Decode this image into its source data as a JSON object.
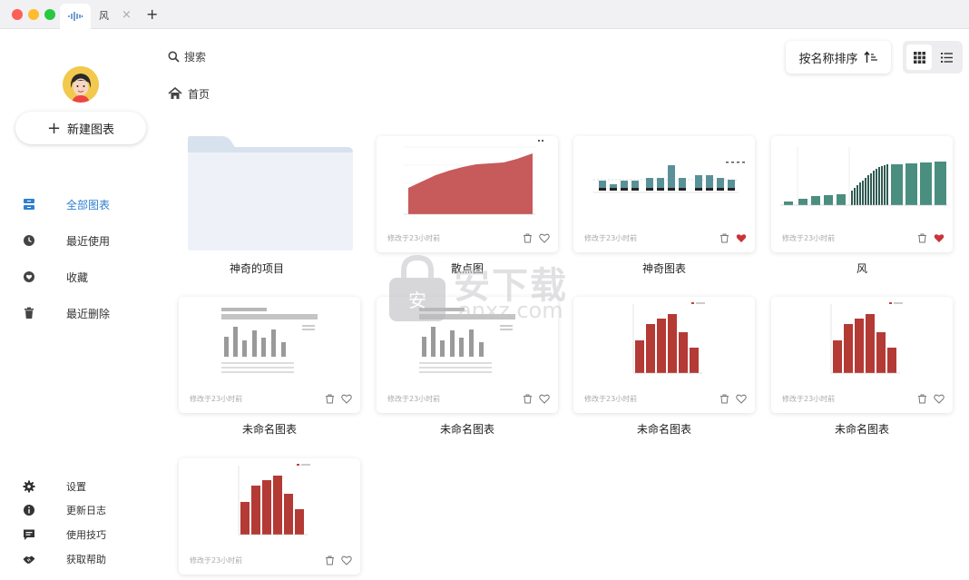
{
  "window": {
    "tabs": [
      {
        "label": "",
        "icon": "waveform-icon",
        "active": true
      },
      {
        "label": "风",
        "active": false
      }
    ],
    "add_tab_label": "+",
    "close_tab_label": "×"
  },
  "sidebar": {
    "new_chart_label": "新建图表",
    "nav": [
      {
        "label": "全部图表",
        "icon": "all-charts-icon",
        "active": true
      },
      {
        "label": "最近使用",
        "icon": "clock-icon",
        "active": false
      },
      {
        "label": "收藏",
        "icon": "heart-icon",
        "active": false
      },
      {
        "label": "最近删除",
        "icon": "trash-icon",
        "active": false
      }
    ],
    "footer": [
      {
        "label": "设置",
        "icon": "gear-icon"
      },
      {
        "label": "更新日志",
        "icon": "info-icon"
      },
      {
        "label": "使用技巧",
        "icon": "message-icon"
      },
      {
        "label": "获取帮助",
        "icon": "handshake-icon"
      }
    ]
  },
  "toolbar": {
    "search_placeholder": "搜索",
    "breadcrumb_home": "首页",
    "sort_label": "按名称排序",
    "view_mode": "grid"
  },
  "colors": {
    "accent": "#2f7fd1",
    "red_chart": "#c0423d",
    "teal_chart": "#4a8e80",
    "favorite": "#c9343a"
  },
  "items": [
    {
      "type": "folder",
      "title": "神奇的项目"
    },
    {
      "type": "chart",
      "title": "散点图",
      "thumb": "area",
      "modified": "修改于23小时前",
      "favorite": false
    },
    {
      "type": "chart",
      "title": "神奇图表",
      "thumb": "teal-bars",
      "modified": "修改于23小时前",
      "favorite": true
    },
    {
      "type": "chart",
      "title": "风",
      "thumb": "teal-rising",
      "modified": "修改于23小时前",
      "favorite": true
    },
    {
      "type": "chart",
      "title": "未命名图表",
      "thumb": "gray-bars",
      "modified": "修改于23小时前",
      "favorite": false
    },
    {
      "type": "chart",
      "title": "未命名图表",
      "thumb": "gray-bars",
      "modified": "修改于23小时前",
      "favorite": false
    },
    {
      "type": "chart",
      "title": "未命名图表",
      "thumb": "red-bars",
      "modified": "修改于23小时前",
      "favorite": false
    },
    {
      "type": "chart",
      "title": "未命名图表",
      "thumb": "red-bars",
      "modified": "修改于23小时前",
      "favorite": false
    },
    {
      "type": "chart",
      "title": "",
      "thumb": "red-bars",
      "modified": "修改于23小时前",
      "favorite": false
    }
  ],
  "watermark": {
    "text": "安下载",
    "sub": "anxz.com"
  }
}
